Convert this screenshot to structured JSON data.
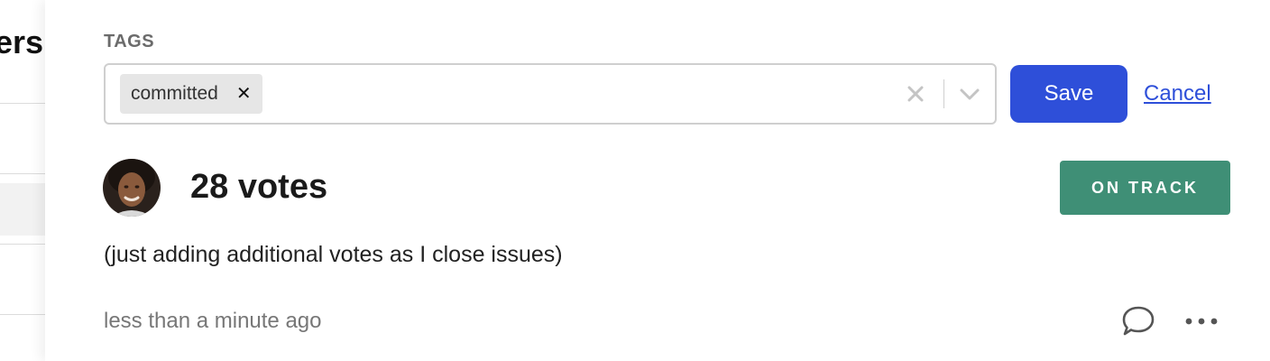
{
  "background": {
    "heading_fragment": "ers"
  },
  "tags": {
    "label": "TAGS",
    "chips": [
      {
        "label": "committed",
        "remove_icon": "close-icon"
      }
    ],
    "clear_icon": "clear-icon",
    "dropdown_icon": "chevron-down-icon"
  },
  "actions": {
    "save_label": "Save",
    "cancel_label": "Cancel"
  },
  "vote": {
    "avatar_icon": "user-avatar",
    "count_label": "28 votes",
    "status": "ON TRACK",
    "message": "(just adding additional votes as I close issues)",
    "timestamp": "less than a minute ago"
  },
  "footer_icons": {
    "comment": "comment-icon",
    "more": "more-options-icon"
  },
  "colors": {
    "primary": "#2e4fd9",
    "status_on_track": "#3f8f76",
    "muted_text": "#777777"
  }
}
